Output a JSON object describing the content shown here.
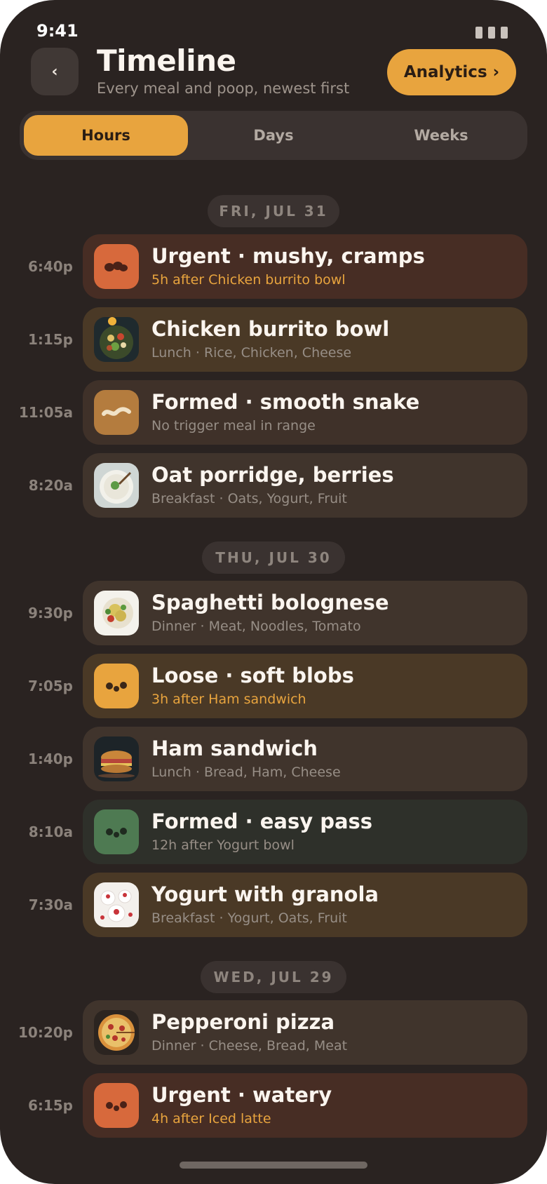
{
  "status_bar": {
    "time": "9:41"
  },
  "header": {
    "back_label": "‹",
    "title": "Timeline",
    "subtitle": "Every meal and poop, newest first",
    "analytics_label": "Analytics ›"
  },
  "segments": [
    {
      "label": "Hours",
      "active": true
    },
    {
      "label": "Days",
      "active": false
    },
    {
      "label": "Weeks",
      "active": false
    }
  ],
  "days": [
    {
      "date": "FRI, JUL 31",
      "entries": [
        {
          "time": "6:40p",
          "title": "Urgent · mushy, cramps",
          "sub": "5h after Chicken burrito bowl",
          "kind": "poop-urgent-icon"
        },
        {
          "time": "1:15p",
          "title": "Chicken burrito bowl",
          "sub": "Lunch · Rice, Chicken, Cheese",
          "kind": "burrito-bowl-photo"
        },
        {
          "time": "11:05a",
          "title": "Formed · smooth snake",
          "sub": "No trigger meal in range",
          "kind": "poop-formed-icon"
        },
        {
          "time": "8:20a",
          "title": "Oat porridge, berries",
          "sub": "Breakfast · Oats, Yogurt, Fruit",
          "kind": "porridge-photo"
        }
      ]
    },
    {
      "date": "THU, JUL 30",
      "entries": [
        {
          "time": "9:30p",
          "title": "Spaghetti bolognese",
          "sub": "Dinner · Meat, Noodles, Tomato",
          "kind": "spaghetti-photo"
        },
        {
          "time": "7:05p",
          "title": "Loose · soft blobs",
          "sub": "3h after Ham sandwich",
          "kind": "poop-loose-icon"
        },
        {
          "time": "1:40p",
          "title": "Ham sandwich",
          "sub": "Lunch · Bread, Ham, Cheese",
          "kind": "sandwich-photo"
        },
        {
          "time": "8:10a",
          "title": "Formed · easy pass",
          "sub": "12h after Yogurt bowl",
          "kind": "poop-easy-icon"
        },
        {
          "time": "7:30a",
          "title": "Yogurt with granola",
          "sub": "Breakfast · Yogurt, Oats, Fruit",
          "kind": "yogurt-photo"
        }
      ]
    },
    {
      "date": "WED, JUL 29",
      "entries": [
        {
          "time": "10:20p",
          "title": "Pepperoni pizza",
          "sub": "Dinner · Cheese, Bread, Meat",
          "kind": "pizza-photo"
        },
        {
          "time": "6:15p",
          "title": "Urgent · watery",
          "sub": "4h after Iced latte",
          "kind": "poop-urgent-icon"
        }
      ]
    }
  ],
  "colors": {
    "accent": "#e8a43e",
    "urgent": "#d7693c",
    "formed": "#b47c3e",
    "loose": "#e8a43e",
    "easy": "#4e7a52"
  }
}
